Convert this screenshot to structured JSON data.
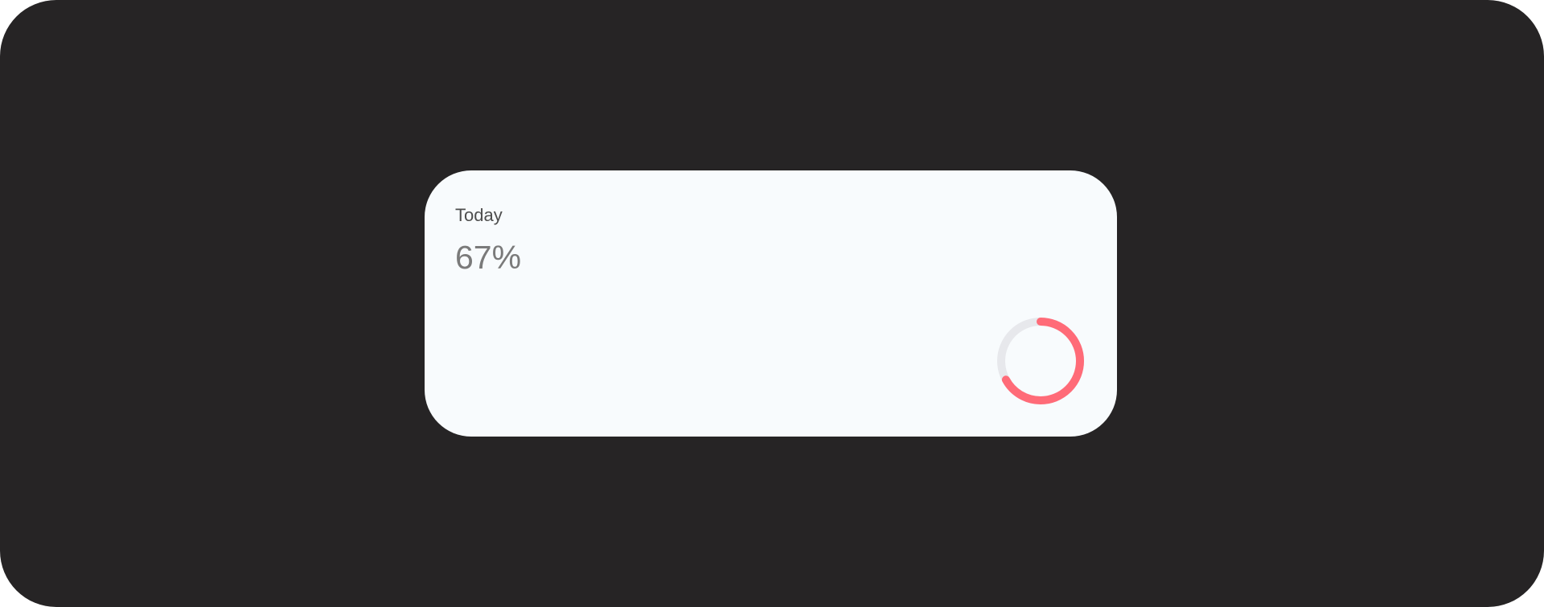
{
  "widget": {
    "label": "Today",
    "percent_text": "67%",
    "percent_value": 0.67,
    "accent_color": "#ff6b78",
    "track_color": "#e7e8ec",
    "card_background": "#f8fbfd",
    "frame_background": "#262425"
  }
}
